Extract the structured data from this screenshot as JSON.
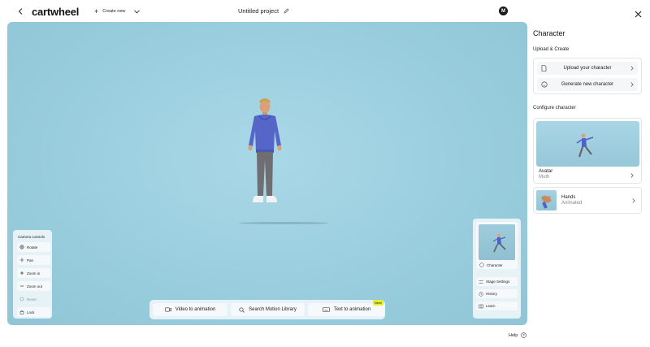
{
  "header": {
    "logo": "cartwheel",
    "create_new": "Create new",
    "project_title": "Untitled project",
    "avatar_initial": "M"
  },
  "camera_controls": {
    "title": "Camera controls",
    "buttons": [
      "Rotate",
      "Pan",
      "Zoom in",
      "Zoom out",
      "Reset",
      "Lock"
    ]
  },
  "action_bar": {
    "video_to_animation": "Video to animation",
    "search_library": "Search Motion Library",
    "text_to_animation": "Text to animation",
    "new_badge": "New!"
  },
  "mini_panel": {
    "character": "Character",
    "stage_settings": "Stage Settings",
    "history": "History",
    "learn": "Learn"
  },
  "side_panel": {
    "title": "Character",
    "upload_section": "Upload & Create",
    "upload_character": "Upload your character",
    "generate_character": "Generate new character",
    "configure_section": "Configure character",
    "avatar_title": "Avatar",
    "avatar_sub": "Muth",
    "hands_title": "Hands",
    "hands_sub": "Animated"
  },
  "footer": {
    "help": "Help"
  },
  "colors": {
    "stage": "#9bcfdf",
    "badge": "#e7f02b",
    "hoodie": "#5566c8"
  }
}
